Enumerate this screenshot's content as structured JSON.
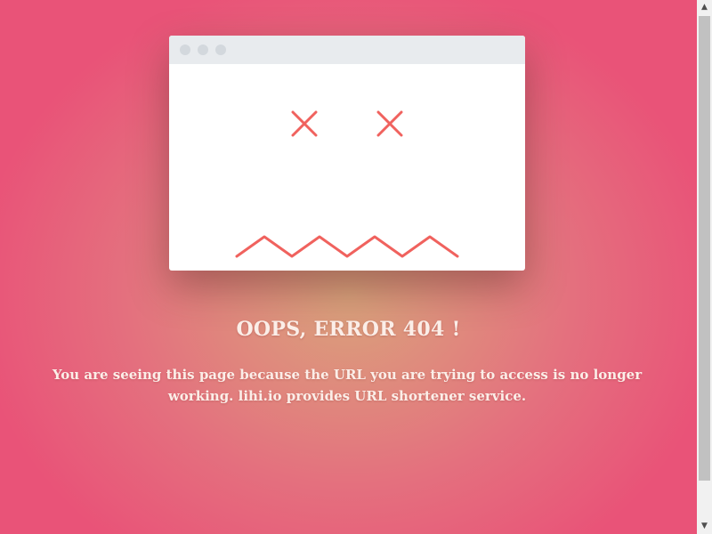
{
  "error_page": {
    "heading": "OOPS, ERROR 404 !",
    "message": "You are seeing this page because the URL you are trying to access is no longer working. lihi.io provides URL shortener service."
  },
  "illustration": {
    "icons": [
      "x-eye-icon",
      "x-eye-icon",
      "zigzag-mouth-icon"
    ],
    "stroke_color": "#f0625e"
  },
  "colors": {
    "background_edge": "#e95378",
    "background_center": "#d9a37c",
    "text": "#fbeee8"
  },
  "scrollbar": {
    "up_icon": "chevron-up-icon",
    "down_icon": "chevron-down-icon"
  }
}
